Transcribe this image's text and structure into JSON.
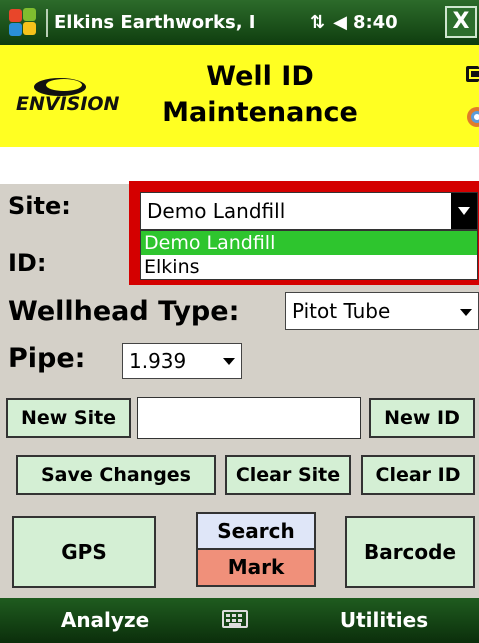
{
  "titlebar": {
    "title": "Elkins Earthworks, I",
    "time": "8:40",
    "close_label": "X",
    "connectivity_icon": "connectivity-icon",
    "volume_icon": "volume-icon"
  },
  "header": {
    "logo_text": "ENVISION",
    "title_line1": "Well ID",
    "title_line2": "Maintenance"
  },
  "form": {
    "site_label": "Site:",
    "site_value": "Demo Landfill",
    "site_options": [
      "Demo Landfill",
      "Elkins"
    ],
    "id_label": "ID:",
    "wellhead_label": "Wellhead Type:",
    "wellhead_value": "Pitot Tube",
    "pipe_label": "Pipe:",
    "pipe_value": "1.939",
    "new_entry_value": ""
  },
  "buttons": {
    "new_site": "New Site",
    "new_id": "New ID",
    "save_changes": "Save Changes",
    "clear_site": "Clear Site",
    "clear_id": "Clear ID",
    "gps": "GPS",
    "search": "Search",
    "mark": "Mark",
    "barcode": "Barcode"
  },
  "menubar": {
    "left": "Analyze",
    "right": "Utilities"
  },
  "colors": {
    "header_bg": "#ffff22",
    "button_bg": "#d4efd4",
    "selected_option": "#2ec52e",
    "dropdown_border": "#d40000",
    "mark_bg": "#f0907a",
    "search_bg": "#dfe6f8"
  }
}
